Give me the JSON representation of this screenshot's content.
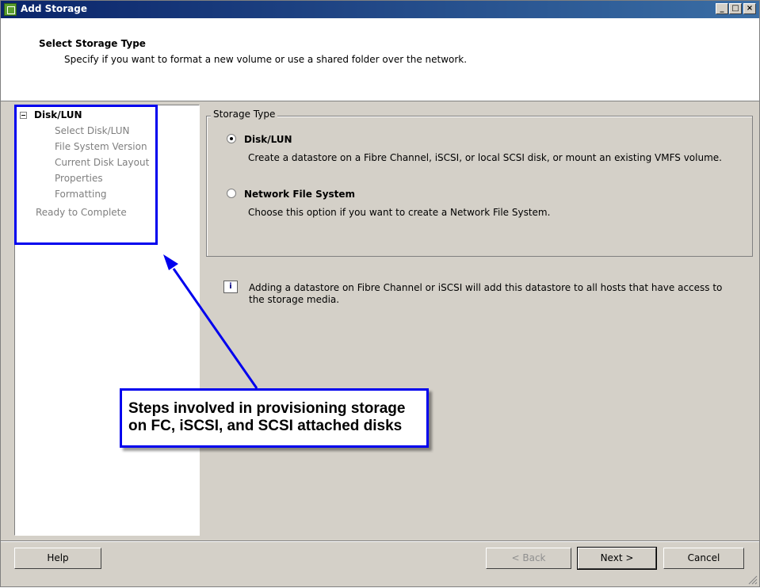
{
  "window": {
    "title": "Add Storage",
    "controls": [
      "_",
      "□",
      "×"
    ]
  },
  "header": {
    "title": "Select Storage Type",
    "subtitle": "Specify if you want to format a new volume or use a shared folder over the network."
  },
  "nav": {
    "group": "Disk/LUN",
    "items": [
      "Select Disk/LUN",
      "File System Version",
      "Current Disk Layout",
      "Properties",
      "Formatting"
    ],
    "final": "Ready to Complete"
  },
  "storage_type": {
    "legend": "Storage Type",
    "options": [
      {
        "label": "Disk/LUN",
        "description": "Create a datastore on a Fibre Channel, iSCSI, or local SCSI disk, or mount an existing VMFS volume.",
        "selected": true
      },
      {
        "label": "Network File System",
        "description": "Choose this option if you want to create a Network File System.",
        "selected": false
      }
    ]
  },
  "info": {
    "icon": "info-icon",
    "text": "Adding a datastore on Fibre Channel or iSCSI will add this datastore to all hosts that have access to the storage media."
  },
  "callout": {
    "line1": "Steps involved in provisioning storage",
    "line2": "on FC, iSCSI, and SCSI attached disks",
    "color": "#0000ee"
  },
  "buttons": {
    "help": "Help",
    "back": "< Back",
    "next": "Next >",
    "cancel": "Cancel"
  }
}
